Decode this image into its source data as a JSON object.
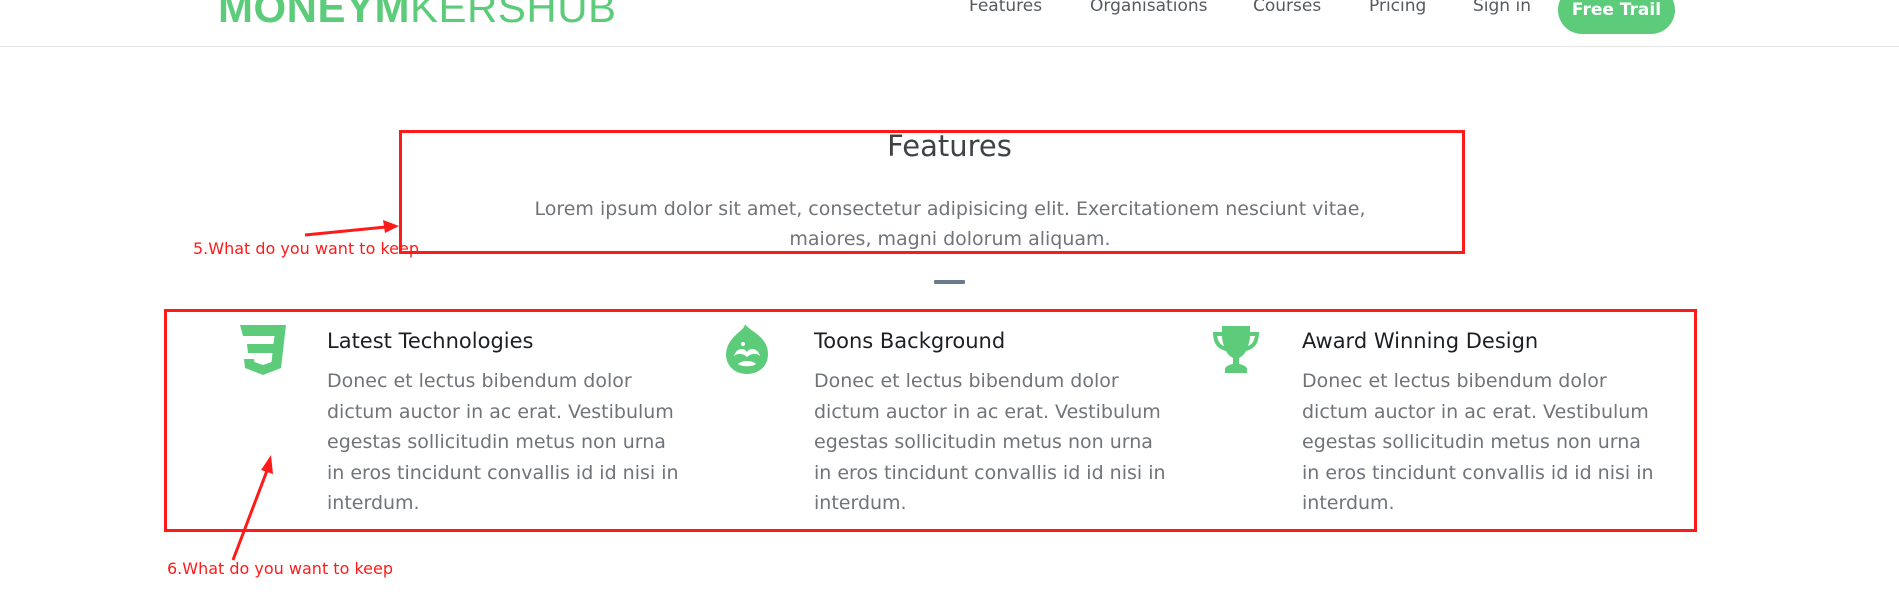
{
  "header": {
    "logo_bold": "MONEYM",
    "logo_light": "KERSHUB",
    "nav": [
      "Features",
      "Organisations",
      "Courses",
      "Pricing",
      "Sign in"
    ],
    "cta_label": "Free Trail",
    "accent_color": "#5ccc7b"
  },
  "intro": {
    "title": "Features",
    "lead": "Lorem ipsum dolor sit amet, consectetur adipisicing elit. Exercitationem nesciunt vitae, maiores, magni dolorum aliquam."
  },
  "features": [
    {
      "icon": "css3-icon",
      "title": "Latest Technologies",
      "text": "Donec et lectus bibendum dolor dictum auctor in ac erat. Vestibulum egestas sollicitudin metus non urna in eros tincidunt convallis id id nisi in interdum."
    },
    {
      "icon": "drupal-icon",
      "title": "Toons Background",
      "text": "Donec et lectus bibendum dolor dictum auctor in ac erat. Vestibulum egestas sollicitudin metus non urna in eros tincidunt convallis id id nisi in interdum."
    },
    {
      "icon": "trophy-icon",
      "title": "Award Winning Design",
      "text": "Donec et lectus bibendum dolor dictum auctor in ac erat. Vestibulum egestas sollicitudin metus non urna in eros tincidunt convallis id id nisi in interdum."
    }
  ],
  "annotations": {
    "note_5": "5.What do you want to keep",
    "note_6": "6.What do you want to keep",
    "color": "#ff1a1a"
  }
}
